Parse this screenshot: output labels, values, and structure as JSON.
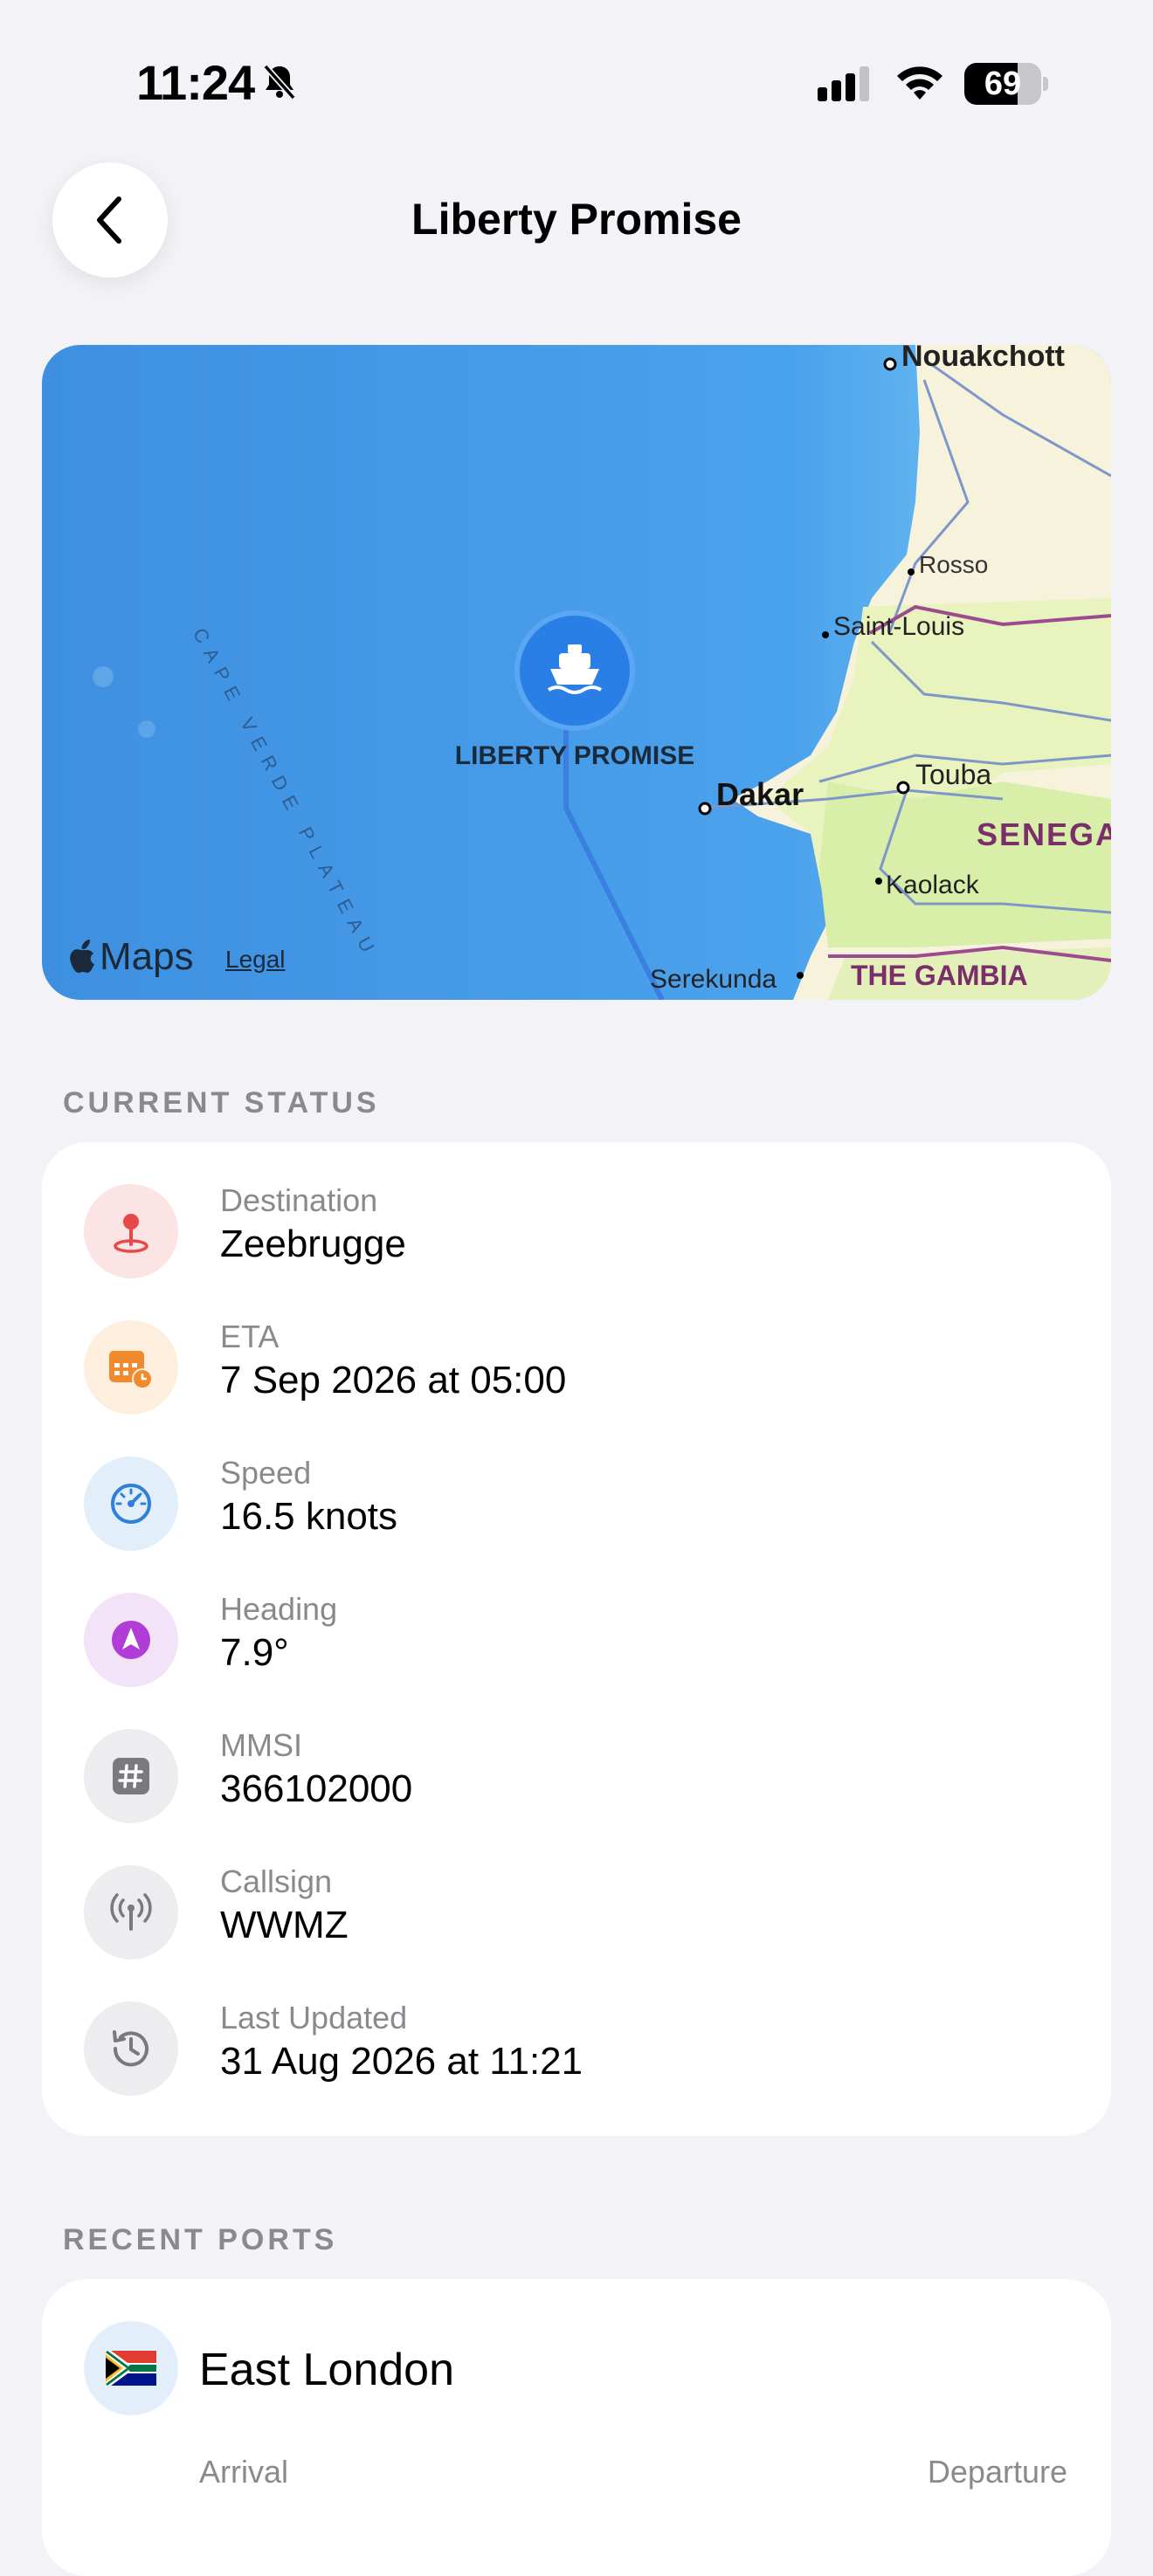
{
  "status_bar": {
    "time": "11:24",
    "battery": "69",
    "battery_level": 0.69
  },
  "header": {
    "title": "Liberty Promise"
  },
  "map": {
    "vessel_label": "LIBERTY PROMISE",
    "labels": {
      "nouakchott": "Nouakchott",
      "rosso": "Rosso",
      "saint_louis": "Saint-Louis",
      "dakar": "Dakar",
      "touba": "Touba",
      "senegal": "SENEGA",
      "kaolack": "Kaolack",
      "serekunda": "Serekunda",
      "gambia": "THE GAMBIA",
      "plateau": "CAPE VERDE PLATEAU"
    },
    "attribution": "Maps",
    "legal": "Legal"
  },
  "current_status": {
    "header": "CURRENT STATUS",
    "rows": [
      {
        "label": "Destination",
        "value": "Zeebrugge",
        "icon": "pin-icon",
        "color": "#E84848",
        "bg": "#FCE4E4"
      },
      {
        "label": "ETA",
        "value": "7 Sep 2026 at 05:00",
        "icon": "calendar-clock-icon",
        "color": "#F08A2C",
        "bg": "#FDEEDD"
      },
      {
        "label": "Speed",
        "value": "16.5 knots",
        "icon": "speedometer-icon",
        "color": "#2F80D8",
        "bg": "#E3EEFB"
      },
      {
        "label": "Heading",
        "value": "7.9°",
        "icon": "location-arrow-icon",
        "color": "#B23CD6",
        "bg": "#F3E3F8"
      },
      {
        "label": "MMSI",
        "value": "366102000",
        "icon": "number-icon",
        "color": "#7A7A7E",
        "bg": "#EDEDEF"
      },
      {
        "label": "Callsign",
        "value": "WWMZ",
        "icon": "antenna-icon",
        "color": "#7A7A7E",
        "bg": "#EDEDEF"
      },
      {
        "label": "Last Updated",
        "value": "31 Aug 2026 at 11:21",
        "icon": "history-icon",
        "color": "#7A7A7E",
        "bg": "#EDEDEF"
      }
    ]
  },
  "recent_ports": {
    "header": "RECENT PORTS",
    "ports": [
      {
        "name": "East London",
        "flag": "south-africa-flag-icon",
        "arrival_label": "Arrival",
        "departure_label": "Departure"
      }
    ]
  }
}
